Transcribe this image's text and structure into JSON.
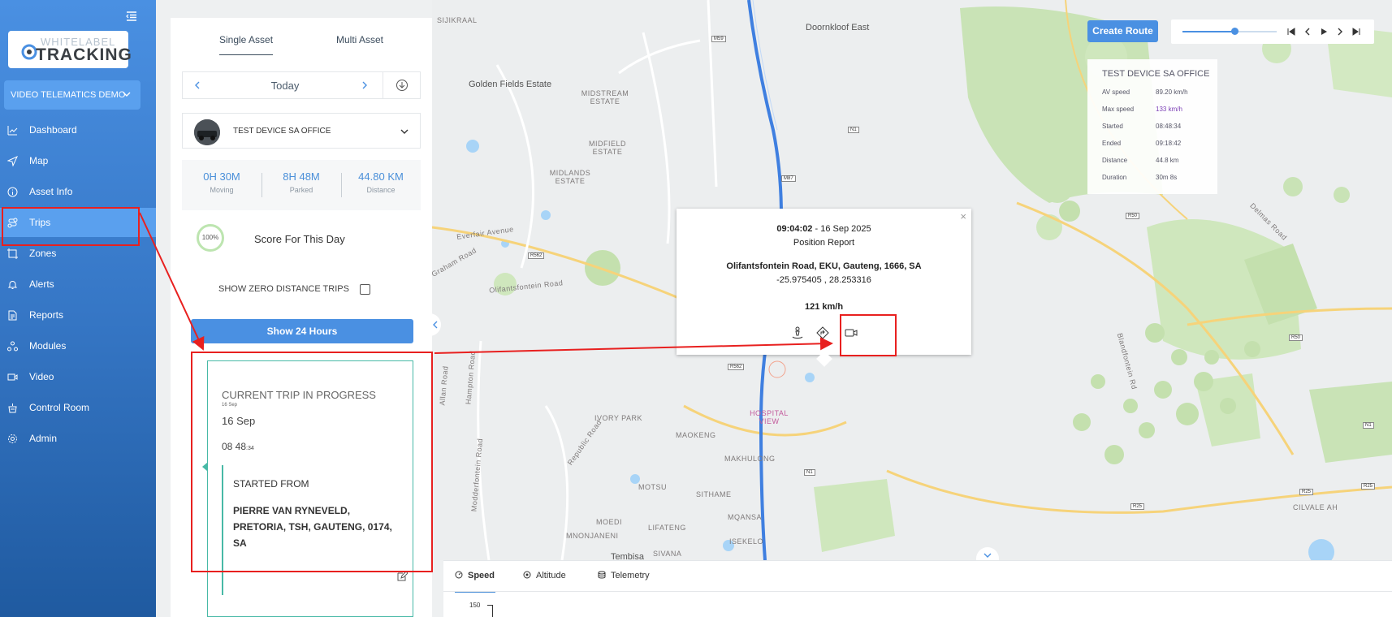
{
  "sidebar": {
    "logo_line1": "WHITELABEL",
    "logo_line2": "TRACKING",
    "account": "VIDEO TELEMATICS DEMO",
    "items": [
      {
        "label": "Dashboard",
        "icon": "dashboard-icon"
      },
      {
        "label": "Map",
        "icon": "map-icon"
      },
      {
        "label": "Asset Info",
        "icon": "info-icon"
      },
      {
        "label": "Trips",
        "icon": "trips-icon"
      },
      {
        "label": "Zones",
        "icon": "zones-icon"
      },
      {
        "label": "Alerts",
        "icon": "bell-icon"
      },
      {
        "label": "Reports",
        "icon": "reports-icon"
      },
      {
        "label": "Modules",
        "icon": "modules-icon"
      },
      {
        "label": "Video",
        "icon": "video-icon"
      },
      {
        "label": "Control Room",
        "icon": "control-room-icon"
      },
      {
        "label": "Admin",
        "icon": "gear-icon"
      }
    ]
  },
  "panel": {
    "tabs": [
      "Single Asset",
      "Multi Asset"
    ],
    "date": "Today",
    "device": "TEST DEVICE SA OFFICE",
    "stats": [
      {
        "value": "0H 30M",
        "label": "Moving"
      },
      {
        "value": "8H 48M",
        "label": "Parked"
      },
      {
        "value": "44.80 KM",
        "label": "Distance"
      }
    ],
    "score_pct": "100%",
    "score_label": "Score For This Day",
    "zero_trips_label": "SHOW ZERO DISTANCE TRIPS",
    "show24_label": "Show 24 Hours",
    "trip": {
      "title": "CURRENT TRIP IN PROGRESS",
      "tiny_date": "16 Sep",
      "date": "16 Sep",
      "time_main": "08 48",
      "time_sec": ":34",
      "started_from": "STARTED FROM",
      "address": "PIERRE VAN RYNEVELD, PRETORIA, TSH, GAUTENG, 0174, SA"
    }
  },
  "map": {
    "create_route": "Create Route",
    "player_progress": 0.55,
    "summary": {
      "title": "TEST DEVICE SA OFFICE",
      "rows": [
        {
          "k": "AV speed",
          "v": "89.20 km/h"
        },
        {
          "k": "Max speed",
          "v": "133 km/h"
        },
        {
          "k": "Started",
          "v": "08:48:34"
        },
        {
          "k": "Ended",
          "v": "09:18:42"
        },
        {
          "k": "Distance",
          "v": "44.8 km"
        },
        {
          "k": "Duration",
          "v": "30m 8s"
        }
      ]
    },
    "popup": {
      "time": "09:04:02",
      "date": " - 16 Sep 2025",
      "type": "Position Report",
      "address": "Olifantsfontein Road, EKU, Gauteng, 1666, SA",
      "coords": "-25.975405 , 28.253316",
      "speed": "121 km/h"
    },
    "labels": [
      "Doornkloof East",
      "Golden Fields Estate",
      "MIDSTREAM ESTATE",
      "MIDFIELD ESTATE",
      "MIDLANDS ESTATE",
      "Everfair Avenue",
      "Olifantsfontein Road",
      "IVORY PARK",
      "MAOKENG",
      "MAKHULONG",
      "HOSPITAL VIEW",
      "MOTSU",
      "SITHAME",
      "MQANSA",
      "ISEKELO",
      "MOEDI",
      "LIFATENG",
      "MNONJANENI",
      "SIVANA",
      "Tembisa",
      "CILVALE AH",
      "Delmas Road",
      "Republic Road",
      "Hampton Road",
      "Allan Road",
      "Modderfontein Road",
      "Graham Road",
      "Blandfontein Rd",
      "SIJIKRAAL"
    ],
    "shields": [
      "M59",
      "N1",
      "M87",
      "R562",
      "R562",
      "N1",
      "R50",
      "R50",
      "R25",
      "R25",
      "R25",
      "N1"
    ]
  },
  "chart": {
    "tabs": [
      "Speed",
      "Altitude",
      "Telemetry"
    ],
    "y_top": "150"
  },
  "colors": {
    "accent": "#4a90e2",
    "teal": "#48b9a6",
    "annotation": "#e8201f",
    "route": "#3f7fe0"
  }
}
